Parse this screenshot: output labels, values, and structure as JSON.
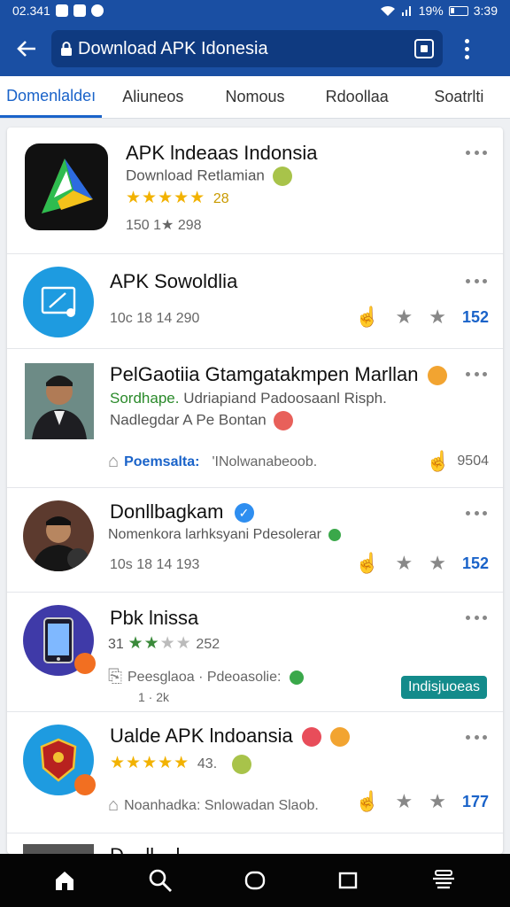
{
  "status_bar": {
    "time_left": "02.341",
    "battery": "19%",
    "time_right": "3:39"
  },
  "browser": {
    "url": "Download APK Idonesia"
  },
  "tabs": [
    {
      "label": "Domenlaldeı",
      "active": true
    },
    {
      "label": "Aliuneos",
      "active": false
    },
    {
      "label": "Nomous",
      "active": false
    },
    {
      "label": "Rdoollaa",
      "active": false
    },
    {
      "label": "Soatrlti",
      "active": false
    }
  ],
  "items": [
    {
      "title": "APK lndeaas Indonsia",
      "subtitle": "Download Retlamian",
      "rating_value": "28",
      "meta": "150 1★ 298",
      "stars": 5
    },
    {
      "title": "APK Sowoldlia",
      "meta": "10c 18 14 290",
      "count": "152"
    },
    {
      "title": "PelGaotiia Gtamgatakmpen Marllan",
      "subtitle_green": "Sordhape.",
      "subtitle_rest": "Udriapiand Padoosaanl Risph.",
      "subtitle2": "Nadlegdar A Pe Bontan",
      "footer_label": "Poemsalta:",
      "footer_text": "'INolwanabeoob.",
      "footer_count": "9504"
    },
    {
      "title": "Donllbagkam",
      "subtitle": "Nomenkora larhksyani Pdesolerar",
      "meta": "10s 18 14 193",
      "count": "152"
    },
    {
      "title": "Pbk lnissa",
      "rating_prefix": "31",
      "rating_value": "252",
      "footer_label": "Peesglaoa · Pdeoasolie:",
      "footer_sub": "1       · 2k",
      "badge": "Indisjuoeas"
    },
    {
      "title": "Ualde APK lndoansia",
      "rating_value": "43.",
      "footer_text": "Noanhadka:  Snlowadan Slaob.",
      "count": "177"
    },
    {
      "title": "D... ll... l...",
      "partial": true
    }
  ],
  "colors": {
    "brand": "#1a4fa3",
    "accent": "#1a63c9",
    "star": "#f2b200",
    "badge": "#138b8b"
  }
}
